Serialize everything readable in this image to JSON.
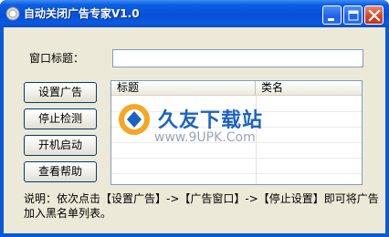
{
  "window": {
    "title": "自动关闭广告专家V1.0",
    "colors": {
      "titlebar": "#0650d8",
      "client": "#ece9d8",
      "close_button": "#d6421f"
    }
  },
  "form": {
    "window_title_label": "窗口标题：",
    "window_title_value": ""
  },
  "buttons": {
    "set_ad": "设置广告",
    "stop_detect": "停止检测",
    "startup": "开机启动",
    "help": "查看帮助"
  },
  "list": {
    "columns": [
      "标题",
      "类名"
    ],
    "rows": []
  },
  "watermark": {
    "brand": "久友下载站",
    "url": "www.9UPK.Com"
  },
  "note": "说明：依次点击【设置广告】->【广告窗口】->【停止设置】即可将广告加入黑名单列表。",
  "icons": [
    "app-icon",
    "minimize-icon",
    "maximize-icon",
    "close-icon"
  ]
}
